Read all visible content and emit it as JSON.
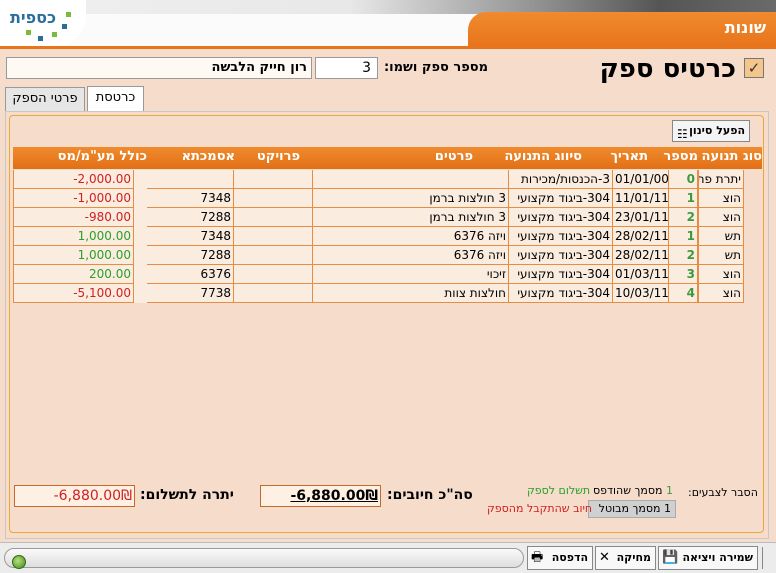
{
  "header": {
    "title": "שונות",
    "logo_text": "כספית"
  },
  "card": {
    "title": "כרטיס ספק",
    "supplier_label": "מספר ספק ושמו:",
    "supplier_number": "3",
    "supplier_name": "רון חייק הלבשה"
  },
  "tabs": [
    {
      "label": "כרטסת",
      "active": true
    },
    {
      "label": "פרטי הספק",
      "active": false
    }
  ],
  "filter_button": "הפעל סינון",
  "table": {
    "columns": [
      "סוג תנועה",
      "מספר",
      "תאריך",
      "סיווג התנועה",
      "פרטים",
      "פרויקט",
      "אסמכתא",
      "כולל מע\"מ/מס"
    ],
    "rows": [
      {
        "type": "יתרת פתיחה",
        "num": "0",
        "date": "01/01/00",
        "class": "3-הכנסות/מכירות",
        "details": "",
        "project": "",
        "ref": "",
        "total": "-2,000.00",
        "sign": "neg"
      },
      {
        "type": "הוצ",
        "num": "1",
        "date": "11/01/11",
        "class": "304-ביגוד מקצועי",
        "details": "3 חולצות ברמן",
        "project": "",
        "ref": "7348",
        "total": "-1,000.00",
        "sign": "neg"
      },
      {
        "type": "הוצ",
        "num": "2",
        "date": "23/01/11",
        "class": "304-ביגוד מקצועי",
        "details": "3 חולצות ברמן",
        "project": "",
        "ref": "7288",
        "total": "-980.00",
        "sign": "neg"
      },
      {
        "type": "תש",
        "num": "1",
        "date": "28/02/11",
        "class": "304-ביגוד מקצועי",
        "details": "ויזה 6376",
        "project": "",
        "ref": "7348",
        "total": "1,000.00",
        "sign": "pos"
      },
      {
        "type": "תש",
        "num": "2",
        "date": "28/02/11",
        "class": "304-ביגוד מקצועי",
        "details": "ויזה 6376",
        "project": "",
        "ref": "7288",
        "total": "1,000.00",
        "sign": "pos"
      },
      {
        "type": "הוצ",
        "num": "3",
        "date": "01/03/11",
        "class": "304-ביגוד מקצועי",
        "details": "זיכוי",
        "project": "",
        "ref": "6376",
        "total": "200.00",
        "sign": "pos"
      },
      {
        "type": "הוצ",
        "num": "4",
        "date": "10/03/11",
        "class": "304-ביגוד מקצועי",
        "details": "חולצות צוות",
        "project": "",
        "ref": "7738",
        "total": "-5,100.00",
        "sign": "neg"
      }
    ]
  },
  "legend": {
    "label": "הסבר לצבעים:",
    "printed_num": "1",
    "printed": "מסמך שהודפס",
    "cancelled_num": "1",
    "cancelled": "מסמך מבוטל",
    "payment": "תשלום לספק",
    "charge": "חיוב שהתקבל מהספק"
  },
  "summary": {
    "total_label": "סה\"כ חיובים:",
    "total_value": "-6,880.00₪",
    "balance_label": "יתרה לתשלום:",
    "balance_value": "-6,880.00₪"
  },
  "toolbar": {
    "save_exit": "שמירה ויציאה",
    "delete": "מחיקה",
    "print": "הדפסה"
  },
  "colors": {
    "accent": "#e8741c",
    "background": "#f5dccb",
    "negative": "#d02020",
    "positive": "#2ba02b"
  }
}
